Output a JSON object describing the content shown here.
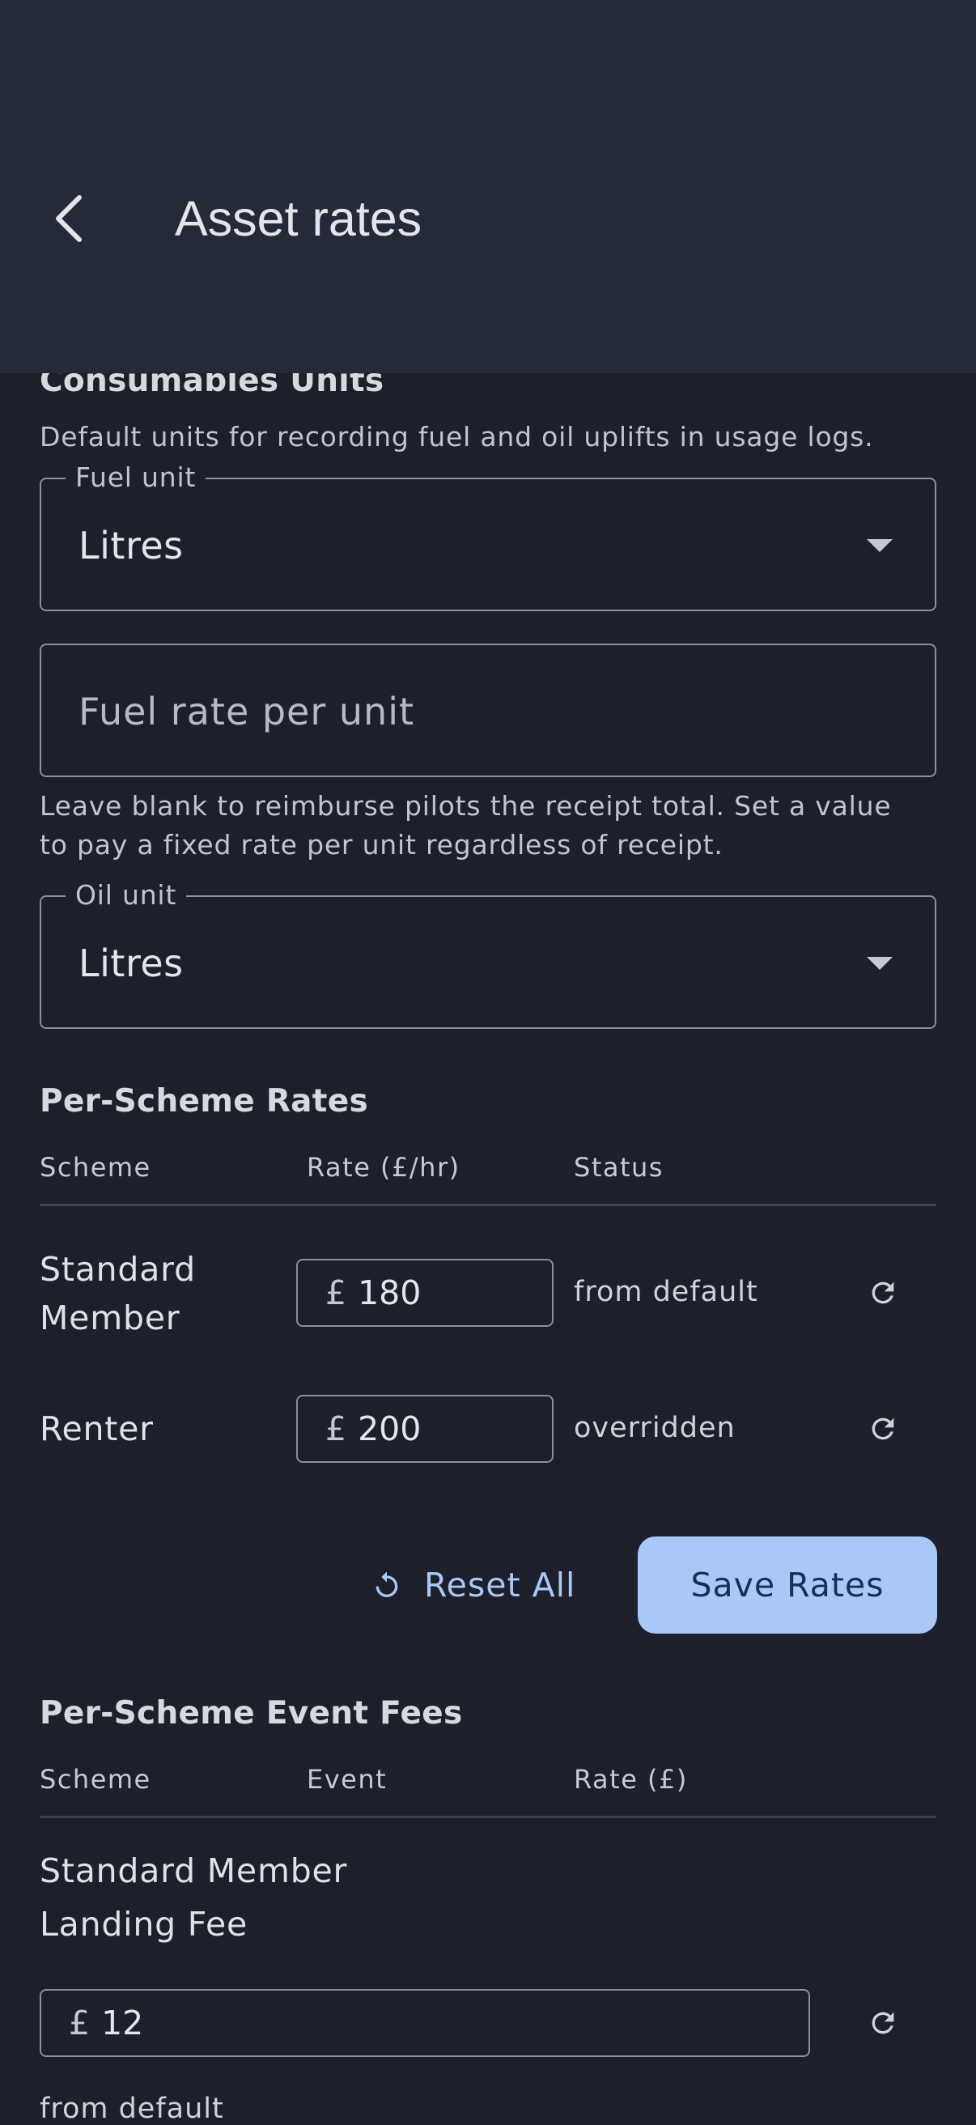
{
  "appbar": {
    "title": "Asset rates",
    "back_icon": "chevron-left-icon"
  },
  "consumables": {
    "heading": "Consumables Units",
    "description": "Default units for recording fuel and oil uplifts in usage logs.",
    "fuel_unit": {
      "label": "Fuel unit",
      "value": "Litres"
    },
    "fuel_rate": {
      "placeholder": "Fuel rate per unit"
    },
    "fuel_rate_helper_line1": "Leave blank to reimburse pilots the receipt total. Set a value",
    "fuel_rate_helper_line2": "to pay a fixed rate per unit regardless of receipt.",
    "oil_unit": {
      "label": "Oil unit",
      "value": "Litres"
    }
  },
  "scheme_rates": {
    "heading": "Per-Scheme Rates",
    "columns": [
      "Scheme",
      "Rate (£/hr)",
      "Status"
    ],
    "currency_symbol": "£",
    "rows": [
      {
        "scheme_line1": "Standard",
        "scheme_line2": "Member",
        "rate": "180",
        "status": "from default"
      },
      {
        "scheme_line1": "Renter",
        "scheme_line2": "",
        "rate": "200",
        "status": "overridden"
      }
    ],
    "reset_all_label": "Reset All",
    "save_label": "Save Rates"
  },
  "event_fees": {
    "heading": "Per-Scheme Event Fees",
    "columns": [
      "Scheme",
      "Event",
      "Rate (£)"
    ],
    "currency_symbol": "£",
    "rows": [
      {
        "scheme": "Standard Member",
        "event": "Landing Fee",
        "rate": "12",
        "status": "from default"
      }
    ]
  },
  "colors": {
    "background": "#1d202a",
    "appbar": "#252a38",
    "accent": "#a8c8f8",
    "outline": "#8c8f99"
  }
}
